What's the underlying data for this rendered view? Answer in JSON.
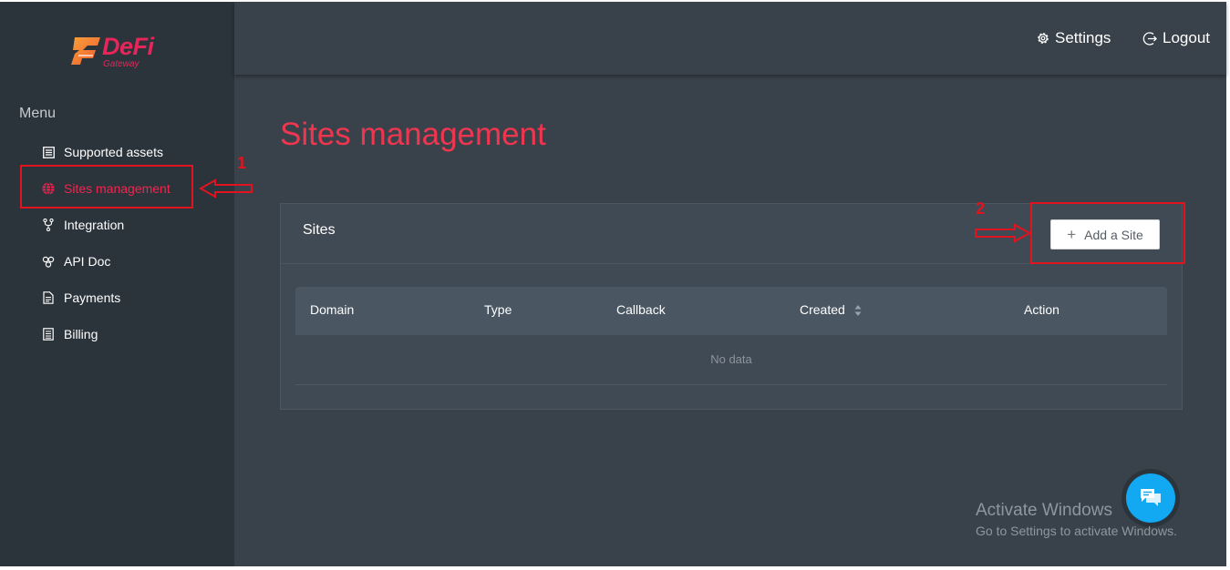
{
  "brand": {
    "name": "DeFi",
    "sub": "Gateway"
  },
  "sidebar": {
    "title": "Menu",
    "items": [
      {
        "label": "Supported assets",
        "icon": "list-icon"
      },
      {
        "label": "Sites management",
        "icon": "globe-icon",
        "active": true
      },
      {
        "label": "Integration",
        "icon": "fork-icon"
      },
      {
        "label": "API Doc",
        "icon": "api-icon"
      },
      {
        "label": "Payments",
        "icon": "document-icon"
      },
      {
        "label": "Billing",
        "icon": "billing-icon"
      }
    ]
  },
  "header": {
    "settings_label": "Settings",
    "logout_label": "Logout"
  },
  "main": {
    "title": "Sites management",
    "card_title": "Sites",
    "add_button_label": "Add a Site",
    "table": {
      "columns": [
        "Domain",
        "Type",
        "Callback",
        "Created",
        "Action"
      ],
      "empty_text": "No data"
    }
  },
  "annotations": {
    "marker_1": "1",
    "marker_2": "2"
  },
  "watermark": {
    "line1": "Activate Windows",
    "line2": "Go to Settings to activate Windows."
  },
  "colors": {
    "accent": "#f0364f",
    "sidebar_bg": "#2b333b",
    "content_bg": "#39424b",
    "highlight": "#e0141e",
    "chat": "#13a8f2"
  }
}
